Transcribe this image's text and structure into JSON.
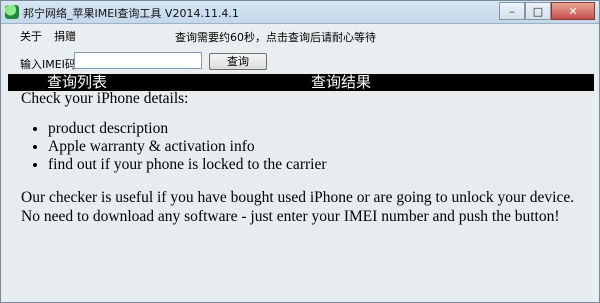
{
  "window": {
    "title": "邦宁网络_苹果IMEI查询工具 V2014.11.4.1"
  },
  "menu": {
    "items": [
      "关于",
      "捐赠"
    ]
  },
  "notice": "查询需要约60秒，点击查询后请耐心等待",
  "form": {
    "label": "输入IMEI码:",
    "input_value": "",
    "button_label": "查询"
  },
  "tabs": [
    "查询列表",
    "查询结果"
  ],
  "content": {
    "heading": "Check your iPhone details:",
    "bullets": [
      "product description",
      "Apple warranty & activation info",
      "find out if your phone is locked to the carrier"
    ],
    "paragraph_lines": [
      "Our checker is useful if you have bought used iPhone or are going to unlock your device.",
      "No need to download any software - just enter your IMEI number and push the button!"
    ]
  },
  "window_controls": {
    "minimize": "–",
    "maximize": "□",
    "close": "✕"
  }
}
